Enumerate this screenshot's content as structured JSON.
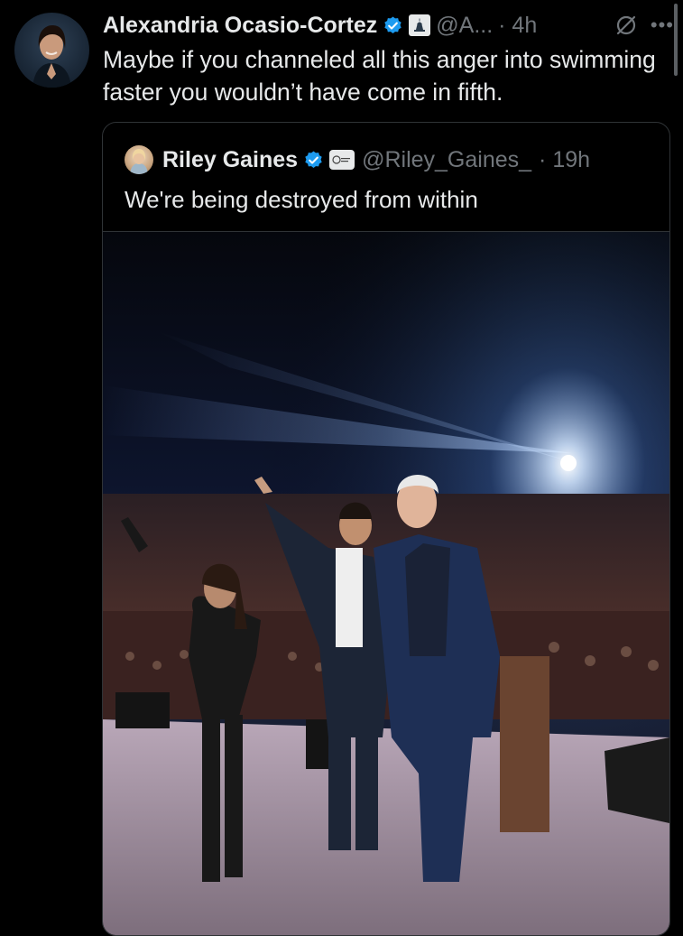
{
  "post": {
    "author_name": "Alexandria Ocasio-Cortez",
    "handle": "@A...",
    "time": "· 4h",
    "text": "Maybe if you channeled all this anger into swimming faster you wouldn’t have come in fifth.",
    "more_glyph": "•••",
    "icons": [
      "verified-badge-icon",
      "capitol-affiliation-icon",
      "grok-icon",
      "more-icon"
    ]
  },
  "quote": {
    "author_name": "Riley Gaines",
    "handle": "@Riley_Gaines_",
    "time": "· 19h",
    "text": "We're being destroyed from within",
    "icons": [
      "verified-badge-icon",
      "affiliation-logo-icon"
    ]
  },
  "colors": {
    "background": "#000000",
    "text": "#e7e9ea",
    "secondary": "#71767b",
    "verified": "#1d9bf0",
    "border": "#2f3336"
  }
}
